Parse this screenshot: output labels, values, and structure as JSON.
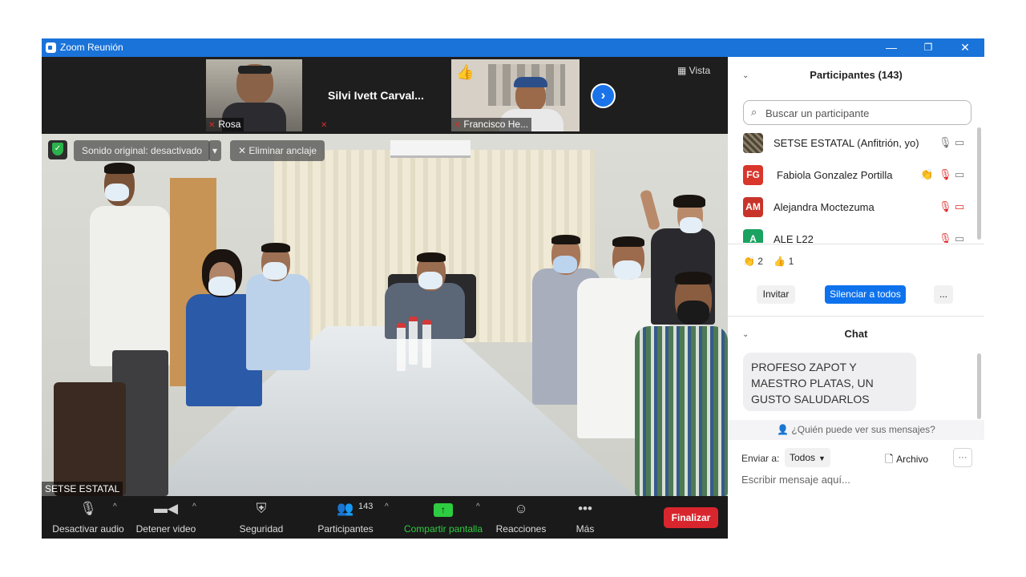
{
  "window": {
    "title": "Zoom Reunión",
    "minimize": "—",
    "restore": "❐",
    "close": "✕"
  },
  "gallery": {
    "participants": [
      {
        "name": "Rosa"
      },
      {
        "name": "Silvi  Ivett  Carval..."
      },
      {
        "name": "Francisco He..."
      }
    ],
    "next_arrow": "›",
    "view_label": "Vista",
    "thumb_reaction": "👍"
  },
  "main_video": {
    "audio_pill": "Sonido original: desactivado",
    "audio_caret": "▾",
    "unpin_label": "Eliminar anclaje",
    "speaker_name": "SETSE ESTATAL"
  },
  "toolbar": {
    "mute": "Desactivar audio",
    "video": "Detener video",
    "security": "Seguridad",
    "participants": "Participantes",
    "participants_count": "143",
    "share": "Compartir pantalla",
    "reactions": "Reacciones",
    "more": "Más",
    "end": "Finalizar",
    "caret": "^"
  },
  "participants_panel": {
    "title": "Participantes (143)",
    "search_placeholder": "Buscar un participante",
    "list": [
      {
        "initials": "",
        "name": "SETSE ESTATAL (Anfitrión, yo)",
        "avatar_color": "#5a5040"
      },
      {
        "initials": "FG",
        "name": "Fabiola Gonzalez Portilla",
        "avatar_color": "#d9362c"
      },
      {
        "initials": "AM",
        "name": "Alejandra Moctezuma",
        "avatar_color": "#c8342a"
      },
      {
        "initials": "A",
        "name": "ALE L22",
        "avatar_color": "#1aa260"
      }
    ],
    "reactions": [
      {
        "icon": "👏",
        "count": "2"
      },
      {
        "icon": "👍",
        "count": "1"
      }
    ],
    "invite": "Invitar",
    "mute_all": "Silenciar a todos",
    "more": "..."
  },
  "chat_panel": {
    "title": "Chat",
    "message": "PROFESO ZAPOT Y MAESTRO PLATAS, UN GUSTO SALUDARLOS",
    "who_can_see": "¿Quién puede ver sus mensajes?",
    "send_to_label": "Enviar a:",
    "send_to_value": "Todos",
    "file_label": "Archivo",
    "more": "···",
    "input_placeholder": "Escribir mensaje aquí..."
  },
  "colors": {
    "titlebar": "#1a73d9",
    "end_button": "#d9262e",
    "mute_all_button": "#0e72ed",
    "share_green": "#2ecc40",
    "muted_red": "#e02828"
  }
}
